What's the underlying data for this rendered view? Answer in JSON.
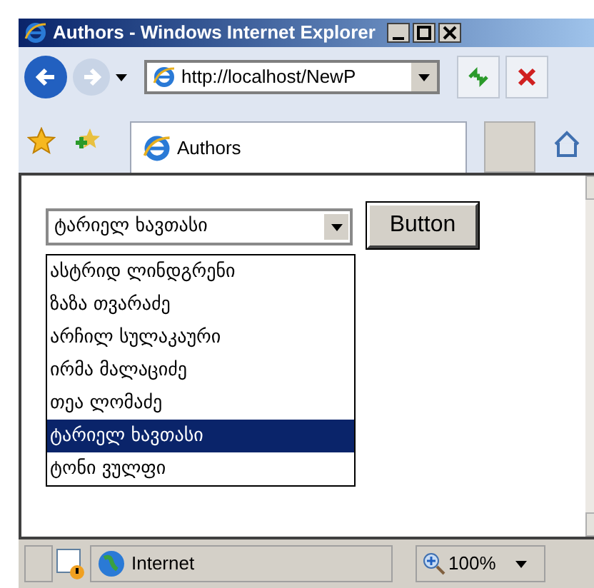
{
  "window": {
    "title": "Authors - Windows Internet Explorer"
  },
  "address_bar": {
    "value": "http://localhost/NewP"
  },
  "tab": {
    "label": "Authors",
    "selected": true
  },
  "page": {
    "select": {
      "value": "ტარიელ ხავთასი",
      "expanded": true
    },
    "button": "Button",
    "options": [
      {
        "label": "ასტრიდ ლინდგრენი",
        "selected": false
      },
      {
        "label": "ზაზა თვარაძე",
        "selected": false
      },
      {
        "label": "არჩილ სულაკაური",
        "selected": false
      },
      {
        "label": "ირმა მალაციძე",
        "selected": false
      },
      {
        "label": "თეა ლომაძე",
        "selected": false
      },
      {
        "label": "ტარიელ ხავთასი",
        "selected": true
      },
      {
        "label": "ტონი ვულფი",
        "selected": false
      }
    ]
  },
  "status_bar": {
    "zone": "Internet",
    "zoom": "100%"
  }
}
